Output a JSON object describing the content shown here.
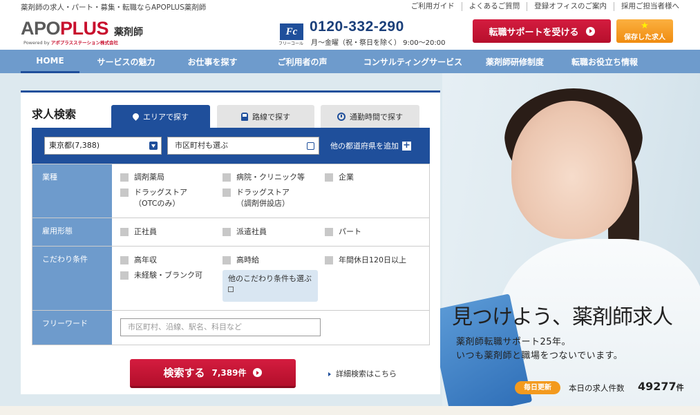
{
  "topbar": {
    "tagline": "薬剤師の求人・パート・募集・転職ならAPOPLUS薬剤師",
    "links": [
      "ご利用ガイド",
      "よくあるご質問",
      "登録オフィスのご案内",
      "採用ご担当者様へ"
    ]
  },
  "header": {
    "logo_prefix": "APO",
    "logo_plus": "PLUS",
    "logo_sub": "薬剤師",
    "logo_powered_prefix": "Powered by ",
    "logo_powered_company": "アポプラスステーション株式会社",
    "phone_icon_text": "Fc",
    "phone_icon_label": "フリーコール",
    "phone_number": "0120-332-290",
    "phone_hours": "月～金曜（祝・祭日を除く） 9:00～20:00",
    "support_button": "転職サポートを受ける",
    "saved_button": "保存した求人",
    "saved_star": "★"
  },
  "nav": {
    "items": [
      "HOME",
      "サービスの魅力",
      "お仕事を探す",
      "ご利用者の声",
      "コンサルティングサービス",
      "薬剤師研修制度",
      "転職お役立ち情報"
    ]
  },
  "search": {
    "title": "求人検索",
    "tabs": {
      "area": "エリアで探す",
      "line": "路線で探す",
      "time": "通勤時間で探す"
    },
    "prefecture_value": "東京都(7,388)",
    "city_placeholder": "市区町村も選ぶ",
    "add_prefecture": "他の都道府県を追加",
    "industry_label": "業種",
    "industry": {
      "pharmacy": "調剤薬局",
      "hospital": "病院・クリニック等",
      "company": "企業",
      "drugstore_otc": "ドラッグストア",
      "drugstore_otc_sub": "（OTCのみ）",
      "drugstore_disp": "ドラッグストア",
      "drugstore_disp_sub": "（調剤併設店）"
    },
    "employment_label": "雇用形態",
    "employment": {
      "fulltime": "正社員",
      "dispatch": "派遣社員",
      "parttime": "パート"
    },
    "conditions_label": "こだわり条件",
    "conditions": {
      "high_income": "高年収",
      "high_hourly": "高時給",
      "holidays": "年間休日120日以上",
      "inexperienced": "未経験・ブランク可",
      "more": "他のこだわり条件も選ぶ"
    },
    "freeword_label": "フリーワード",
    "freeword_placeholder": "市区町村、沿線、駅名、科目など",
    "search_button": "検索する",
    "search_count": "7,389件",
    "advanced_link": "詳細検索はこちら"
  },
  "hero": {
    "title": "見つけよう、薬剤師求人",
    "subtitle_1": "薬剤師転職サポート25年。",
    "subtitle_2": "いつも薬剤師と職場をつないでいます。",
    "daily_badge": "毎日更新",
    "count_label": "本日の求人件数",
    "count_value": "49277",
    "count_unit": "件"
  }
}
